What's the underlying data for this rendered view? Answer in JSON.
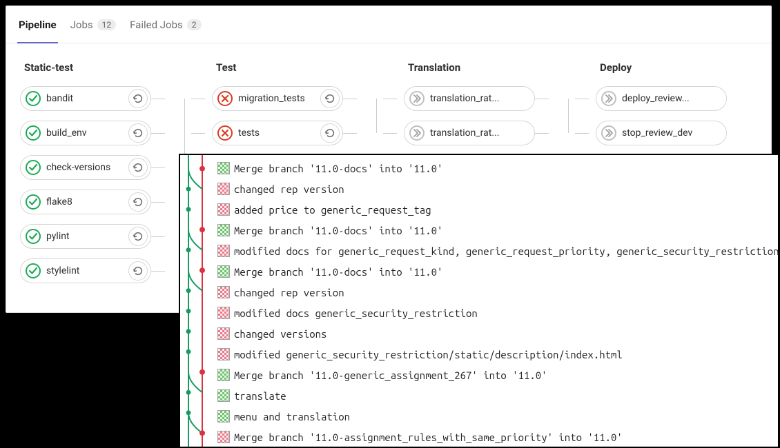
{
  "tabs": {
    "pipeline_label": "Pipeline",
    "jobs_label": "Jobs",
    "jobs_count": "12",
    "failed_label": "Failed Jobs",
    "failed_count": "2"
  },
  "stages": [
    {
      "title": "Static-test",
      "jobs": [
        {
          "name": "bandit",
          "status": "success",
          "retry": true
        },
        {
          "name": "build_env",
          "status": "success",
          "retry": true
        },
        {
          "name": "check-versions",
          "status": "success",
          "retry": true
        },
        {
          "name": "flake8",
          "status": "success",
          "retry": true
        },
        {
          "name": "pylint",
          "status": "success",
          "retry": true
        },
        {
          "name": "stylelint",
          "status": "success",
          "retry": true
        }
      ]
    },
    {
      "title": "Test",
      "jobs": [
        {
          "name": "migration_tests",
          "status": "failed",
          "retry": true
        },
        {
          "name": "tests",
          "status": "failed",
          "retry": true
        }
      ]
    },
    {
      "title": "Translation",
      "jobs": [
        {
          "name": "translation_rat...",
          "status": "skipped",
          "retry": false
        },
        {
          "name": "translation_rat...",
          "status": "skipped",
          "retry": false
        }
      ]
    },
    {
      "title": "Deploy",
      "jobs": [
        {
          "name": "deploy_review...",
          "status": "skipped",
          "retry": false
        },
        {
          "name": "stop_review_dev",
          "status": "skipped",
          "retry": false
        }
      ]
    }
  ],
  "commits": [
    {
      "avatar": "green",
      "msg": "Merge branch '11.0-docs' into '11.0'"
    },
    {
      "avatar": "pink",
      "msg": "changed rep version"
    },
    {
      "avatar": "pink",
      "msg": "added price to generic_request_tag"
    },
    {
      "avatar": "green",
      "msg": "Merge branch '11.0-docs' into '11.0'"
    },
    {
      "avatar": "pink",
      "msg": "modified docs for generic_request_kind, generic_request_priority, generic_security_restriction"
    },
    {
      "avatar": "green",
      "msg": "Merge branch '11.0-docs' into '11.0'"
    },
    {
      "avatar": "pink",
      "msg": "changed rep version"
    },
    {
      "avatar": "pink",
      "msg": "modified docs generic_security_restriction"
    },
    {
      "avatar": "pink",
      "msg": "changed versions"
    },
    {
      "avatar": "pink",
      "msg": "modified generic_security_restriction/static/description/index.html"
    },
    {
      "avatar": "green",
      "msg": "Merge branch '11.0-generic_assignment_267' into '11.0'"
    },
    {
      "avatar": "green",
      "msg": "translate"
    },
    {
      "avatar": "green",
      "msg": "menu and translation"
    },
    {
      "avatar": "pink",
      "msg": "Merge branch '11.0-assignment_rules_with_same_priority' into '11.0'"
    }
  ]
}
